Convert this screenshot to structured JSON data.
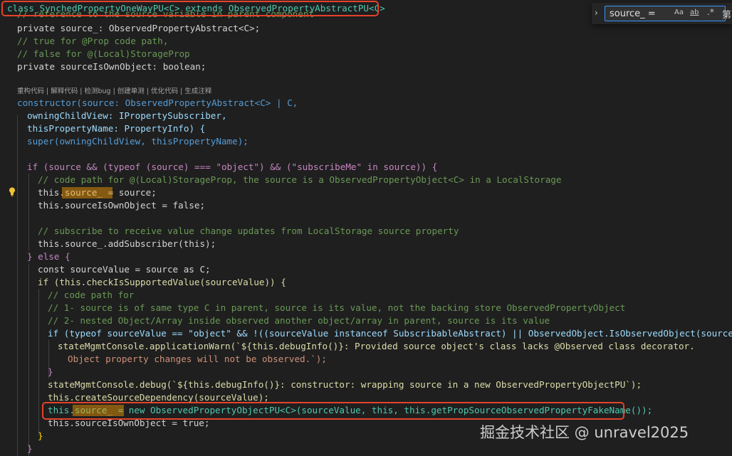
{
  "find_widget": {
    "query": "source_ =",
    "toggle_icon": "chevron-right",
    "match_case_label": "Aa",
    "whole_word_label": "ab",
    "regex_label": ".*",
    "edge_text": "第"
  },
  "codelens": {
    "text": "重构代码 | 解释代码 | 检测bug | 创建单测 | 优化代码 | 生成注释"
  },
  "watermark": {
    "text": "掘金技术社区 @ unravel2025"
  },
  "highlights": {
    "box_color": "#e5422b",
    "match_color": "#c08a1e"
  },
  "code": {
    "class_line": "class SynchedPropertyOneWayPU<C> extends ObservedPropertyAbstractPU<C>",
    "comment_ref": "// reference to the source variable in parent component",
    "private_source": "private source_: ObservedPropertyAbstract<C>;",
    "comment_true": "// true for @Prop code path,",
    "comment_false": "// false for @(Local)StorageProp",
    "private_isown": "private sourceIsOwnObject: boolean;",
    "ctor_line": "constructor(source: ObservedPropertyAbstract<C> | C,",
    "owning_line": "owningChildView: IPropertySubscriber,",
    "thisprop_line": "thisPropertyName: PropertyInfo) {",
    "super_line": "super(owningChildView, thisPropertyName);",
    "if_line": "if (source && (typeof (source) === \"object\") && (\"subscribeMe\" in source)) {",
    "comment_localstorage": "// code path for @(Local)StorageProp, the source is a ObservedPropertyObject<C> in a LocalStorage",
    "assign_source_1": "this.source_ = source;",
    "assign_isown_false": "this.sourceIsOwnObject = false;",
    "comment_subscribe": "// subscribe to receive value change updates from LocalStorage source property",
    "add_subscriber": "this.source_.addSubscriber(this);",
    "else_line": "} else {",
    "const_line": "const sourceValue = source as C;",
    "if_supported": "if (this.checkIsSupportedValue(sourceValue)) {",
    "comment_codepath": "// code path for",
    "comment_1": "// 1- source is of same type C in parent, source is its value, not the backing store ObservedPropertyObject",
    "comment_2": "// 2- nested Object/Array inside observed another object/array in parent, source is its value",
    "if_typeof": "if (typeof sourceValue == \"object\" && !((sourceValue instanceof SubscribableAbstract) || ObservedObject.IsObservedObject(sourceValue)",
    "warn_line_1": "stateMgmtConsole.applicationWarn(`${this.debugInfo()}: Provided source object's class lacks @Observed class decorator.",
    "warn_line_2": "Object property changes will not be observed.`);",
    "close_brace": "}",
    "debug_line": "stateMgmtConsole.debug(`${this.debugInfo()}: constructor: wrapping source in a new ObservedPropertyObjectPU`);",
    "create_dep": "this.createSourceDependency(sourceValue);",
    "assign_new": "this.source_ = new ObservedPropertyObjectPU<C>(sourceValue, this, this.getPropSourceObservedPropertyFakeName());",
    "assign_isown_true": "this.sourceIsOwnObject = true;"
  }
}
